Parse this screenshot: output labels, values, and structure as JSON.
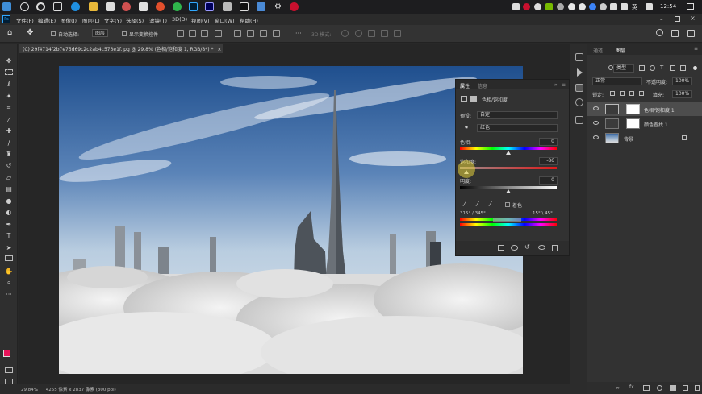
{
  "taskbar": {
    "time": "12:54",
    "lang": "英",
    "app_icons": [
      "search-icon",
      "cortana-icon",
      "task-view-icon",
      "edge-icon",
      "explorer-icon",
      "store-icon",
      "app-icon",
      "app-icon",
      "app-icon",
      "app-icon",
      "app-icon",
      "wechat-icon",
      "app-icon",
      "photoshop-icon",
      "premiere-icon",
      "premiere-icon",
      "app-icon",
      "app-icon",
      "app-icon",
      "app-icon",
      "app-icon",
      "app-icon"
    ]
  },
  "menu": {
    "ps_logo": "Ps",
    "items": [
      "文件(F)",
      "编辑(E)",
      "图像(I)",
      "图层(L)",
      "文字(Y)",
      "选择(S)",
      "滤镜(T)",
      "3D(D)",
      "视图(V)",
      "窗口(W)",
      "帮助(H)"
    ]
  },
  "options": {
    "auto_select": "自动选择:",
    "auto_select_value": "图层",
    "transform": "显示变换控件",
    "mode_3d": "3D 模式:"
  },
  "document": {
    "tab_title": "(C) 29f4714f2b7e75d69c2c2ab4c573e1f.jpg @ 29.8% (色相/饱和度 1, RGB/8*) *",
    "close": "×"
  },
  "status": {
    "zoom": "29.84%",
    "info": "4255 像素 x 2837 像素 (300 ppi)"
  },
  "properties": {
    "tab_properties": "属性",
    "tab_info": "信息",
    "adjustment_name": "色相/饱和度",
    "preset_label": "预设:",
    "preset_value": "自定",
    "channel_value": "红色",
    "hue_label": "色相:",
    "hue_value": "0",
    "hue_level": 0.5,
    "saturation_label": "饱和度:",
    "saturation_value": "-86",
    "saturation_level": 0.07,
    "lightness_label": "明度:",
    "lightness_value": "0",
    "lightness_level": 0.5,
    "colorize_label": "着色",
    "range_left": "315° / 345°",
    "range_right": "15° \\ 45°"
  },
  "layers_panel": {
    "tab_channels": "通道",
    "tab_layers": "图层",
    "filter_kind": "类型",
    "blend_mode": "正常",
    "opacity_label": "不透明度:",
    "opacity_value": "100%",
    "lock_label": "锁定:",
    "fill_label": "填充:",
    "fill_value": "100%",
    "layers": [
      {
        "name": "色相/饱和度 1",
        "type": "adjustment",
        "selected": true
      },
      {
        "name": "颜色查找 1",
        "type": "adjustment",
        "selected": false
      },
      {
        "name": "背景",
        "type": "image",
        "selected": false
      }
    ]
  },
  "colors": {
    "accent": "#2d7fd8",
    "foreground_swatch": "#e8145a",
    "panel_bg": "#323232"
  }
}
